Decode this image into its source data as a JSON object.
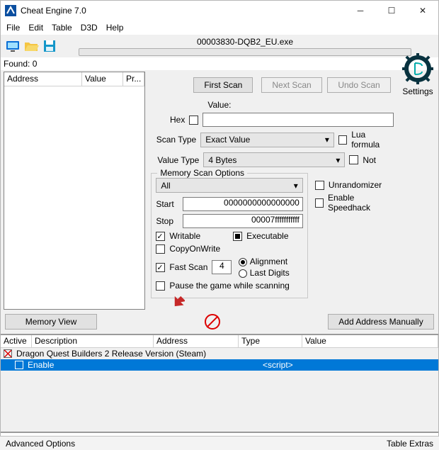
{
  "window": {
    "title": "Cheat Engine 7.0"
  },
  "menus": [
    "File",
    "Edit",
    "Table",
    "D3D",
    "Help"
  ],
  "process": {
    "name": "00003830-DQB2_EU.exe"
  },
  "settings_label": "Settings",
  "found": {
    "label": "Found: 0"
  },
  "results_headers": {
    "address": "Address",
    "value": "Value",
    "previous": "Pr..."
  },
  "buttons": {
    "first_scan": "First Scan",
    "next_scan": "Next Scan",
    "undo_scan": "Undo Scan",
    "memory_view": "Memory View",
    "add_manual": "Add Address Manually"
  },
  "labels": {
    "value": "Value:",
    "hex": "Hex",
    "scan_type": "Scan Type",
    "value_type": "Value Type",
    "lua_formula": "Lua formula",
    "not": "Not",
    "mem_scan": "Memory Scan Options",
    "all": "All",
    "start": "Start",
    "stop": "Stop",
    "writable": "Writable",
    "executable": "Executable",
    "copyonwrite": "CopyOnWrite",
    "fast_scan": "Fast Scan",
    "alignment": "Alignment",
    "last_digits": "Last Digits",
    "pause": "Pause the game while scanning",
    "unrandomizer": "Unrandomizer",
    "speedhack": "Enable Speedhack"
  },
  "combos": {
    "scan_type": "Exact Value",
    "value_type": "4 Bytes"
  },
  "mem": {
    "start": "0000000000000000",
    "stop": "00007fffffffffff",
    "fast_scan_value": "4"
  },
  "table": {
    "headers": {
      "active": "Active",
      "description": "Description",
      "address": "Address",
      "type": "Type",
      "value": "Value"
    },
    "rows": [
      {
        "active": "x",
        "description": "Dragon Quest Builders 2 Release Version (Steam)",
        "type": "",
        "value": ""
      },
      {
        "active": "",
        "indent": true,
        "description": "Enable",
        "type": "<script>",
        "value": "",
        "selected": true
      }
    ]
  },
  "status": {
    "left": "Advanced Options",
    "right": "Table Extras"
  }
}
